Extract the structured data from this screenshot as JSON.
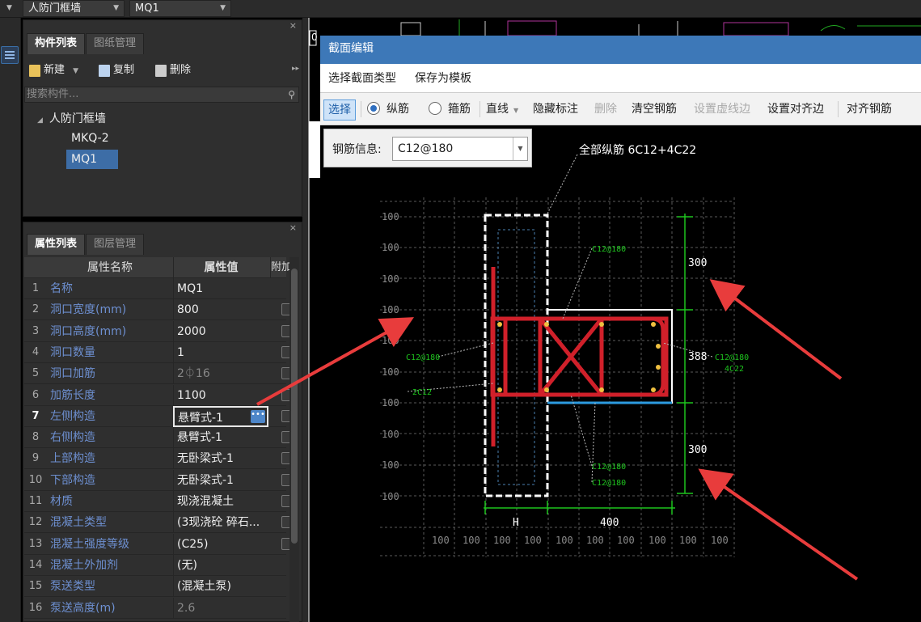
{
  "topbar": {
    "dropdown1": "人防门框墙",
    "dropdown2": "MQ1"
  },
  "component_panel": {
    "tabs": [
      "构件列表",
      "图纸管理"
    ],
    "toolbar": {
      "new": "新建",
      "copy": "复制",
      "delete": "删除"
    },
    "search_placeholder": "搜索构件...",
    "tree": {
      "root": "人防门框墙",
      "items": [
        "MKQ-2",
        "MQ1"
      ],
      "selected": "MQ1"
    }
  },
  "property_panel": {
    "tabs": [
      "属性列表",
      "图层管理"
    ],
    "headers": {
      "name": "属性名称",
      "value": "属性值",
      "extra": "附加"
    },
    "rows": [
      {
        "num": "1",
        "name": "名称",
        "value": "MQ1",
        "checkbox": false
      },
      {
        "num": "2",
        "name": "洞口宽度(mm)",
        "value": "800",
        "checkbox": true
      },
      {
        "num": "3",
        "name": "洞口高度(mm)",
        "value": "2000",
        "checkbox": true
      },
      {
        "num": "4",
        "name": "洞口数量",
        "value": "1",
        "checkbox": true
      },
      {
        "num": "5",
        "name": "洞口加筋",
        "value": "2⏀16",
        "checkbox": true,
        "gray": true
      },
      {
        "num": "6",
        "name": "加筋长度",
        "value": "1100",
        "checkbox": true
      },
      {
        "num": "7",
        "name": "左侧构造",
        "value": "悬臂式-1",
        "checkbox": true,
        "active": true
      },
      {
        "num": "8",
        "name": "右侧构造",
        "value": "悬臂式-1",
        "checkbox": true
      },
      {
        "num": "9",
        "name": "上部构造",
        "value": "无卧梁式-1",
        "checkbox": true
      },
      {
        "num": "10",
        "name": "下部构造",
        "value": "无卧梁式-1",
        "checkbox": true
      },
      {
        "num": "11",
        "name": "材质",
        "value": "现浇混凝土",
        "checkbox": true
      },
      {
        "num": "12",
        "name": "混凝土类型",
        "value": "(3现浇砼 碎石...",
        "checkbox": true
      },
      {
        "num": "13",
        "name": "混凝土强度等级",
        "value": "(C25)",
        "checkbox": true
      },
      {
        "num": "14",
        "name": "混凝土外加剂",
        "value": "(无)",
        "checkbox": false
      },
      {
        "num": "15",
        "name": "泵送类型",
        "value": "(混凝土泵)",
        "checkbox": false
      },
      {
        "num": "16",
        "name": "泵送高度(m)",
        "value": "2.6",
        "checkbox": false,
        "gray": true
      }
    ]
  },
  "dialog": {
    "title": "截面编辑",
    "menu": [
      "选择截面类型",
      "保存为模板"
    ],
    "tools": {
      "select": "选择",
      "longitudinal": "纵筋",
      "stirrup": "箍筋",
      "line": "直线",
      "hide_annot": "隐藏标注",
      "delete": "删除",
      "clear": "清空钢筋",
      "set_virtual": "设置虚线边",
      "set_align": "设置对齐边",
      "align_rebar": "对齐钢筋"
    },
    "rebar_info_label": "钢筋信息:",
    "rebar_info_value": "C12@180"
  },
  "drawing": {
    "all_longitudinal": "全部纵筋 6C12+4C22",
    "left_grid_label": "100",
    "bottom_grid_label": "100",
    "dim_top_right": "300",
    "dim_mid_right": "388",
    "dim_bottom_right": "300",
    "dim_bottom_H": "H",
    "dim_bottom_400": "400",
    "ann_c12_180_top": "C12@180",
    "ann_c12_180_left": "C12@180",
    "ann_2c12": "2C12",
    "ann_c12_180_right": "C12@180",
    "ann_4c22": "4C22",
    "ann_c12_180_b1": "C12@180",
    "ann_c12_180_b2": "C12@180",
    "colors": {
      "rebar": "#d0202a",
      "dim": "#1ec41e",
      "outline_white": "#ffffff",
      "align_edge": "#2d9be0",
      "arrow": "#e83c3c"
    }
  }
}
